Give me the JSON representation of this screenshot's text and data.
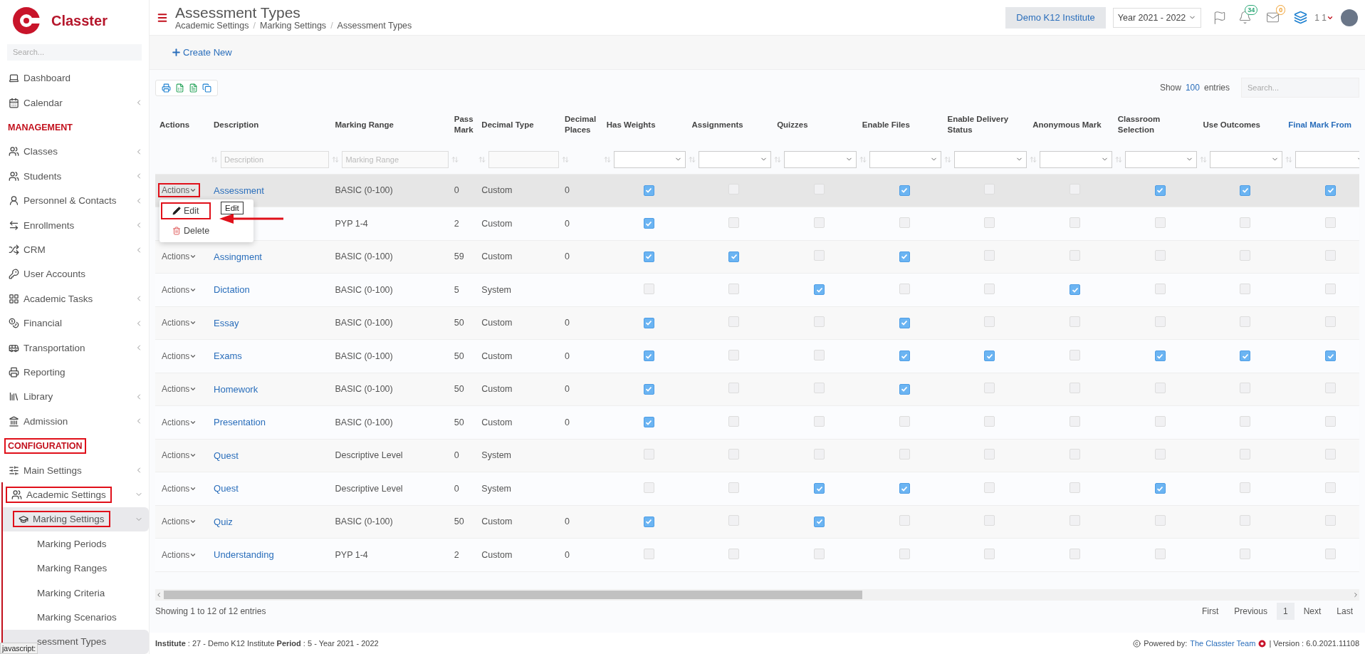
{
  "brand": {
    "name": "Classter"
  },
  "sidebar": {
    "search": {
      "placeholder": "Search..."
    },
    "items": [
      {
        "kind": "item",
        "label": "Dashboard"
      },
      {
        "kind": "item",
        "label": "Calendar",
        "expanded": false
      },
      {
        "kind": "section",
        "label": "MANAGEMENT",
        "annotated": false
      },
      {
        "kind": "item",
        "label": "Classes",
        "expanded": false
      },
      {
        "kind": "item",
        "label": "Students",
        "expanded": false
      },
      {
        "kind": "item",
        "label": "Personnel & Contacts",
        "expanded": false
      },
      {
        "kind": "item",
        "label": "Enrollments",
        "expanded": false
      },
      {
        "kind": "item",
        "label": "CRM",
        "expanded": false
      },
      {
        "kind": "item",
        "label": "User Accounts"
      },
      {
        "kind": "item",
        "label": "Academic Tasks",
        "expanded": false
      },
      {
        "kind": "item",
        "label": "Financial",
        "expanded": false
      },
      {
        "kind": "item",
        "label": "Transportation",
        "expanded": false
      },
      {
        "kind": "item",
        "label": "Reporting"
      },
      {
        "kind": "item",
        "label": "Library",
        "expanded": false
      },
      {
        "kind": "item",
        "label": "Admission",
        "expanded": false
      },
      {
        "kind": "section",
        "label": "CONFIGURATION",
        "annotated": true
      },
      {
        "kind": "item",
        "label": "Main Settings",
        "expanded": false
      },
      {
        "kind": "item",
        "label": "Academic Settings",
        "expanded": true,
        "annotated": true,
        "children": [
          {
            "label": "Marking Settings",
            "expanded": true,
            "annotated": true,
            "children": [
              {
                "label": "Marking Periods",
                "selected": false
              },
              {
                "label": "Marking Ranges",
                "selected": false
              },
              {
                "label": "Marking Criteria",
                "selected": false
              },
              {
                "label": "Marking Scenarios",
                "selected": false
              },
              {
                "label": "sessment Types",
                "selected": true
              }
            ]
          }
        ]
      }
    ],
    "status_tip": "javascript:"
  },
  "header": {
    "title": "Assessment Types",
    "breadcrumb": [
      "Academic Settings",
      "Marking Settings",
      "Assessment Types"
    ],
    "separator": "/",
    "institute": "Demo K12 Institute",
    "year": "Year 2021 - 2022",
    "notifications": "34",
    "messages": "0",
    "user": "1 1"
  },
  "toolbar": {
    "create": "Create New"
  },
  "table_tools": {
    "show": "Show",
    "page_size": "100",
    "entries": "entries",
    "search": {
      "placeholder": "Search..."
    }
  },
  "columns": [
    {
      "label": "Actions",
      "kind": "action",
      "sorted": false,
      "filter": {
        "kind": "none"
      }
    },
    {
      "label": "Description",
      "kind": "link",
      "sorted": false,
      "filter": {
        "kind": "text",
        "placeholder": "Description"
      }
    },
    {
      "label": "Marking Range",
      "kind": "text",
      "sorted": false,
      "filter": {
        "kind": "text",
        "placeholder": "Marking Range"
      }
    },
    {
      "label": "Pass Mark",
      "kind": "text",
      "sorted": false,
      "filter": {
        "kind": "none"
      }
    },
    {
      "label": "Decimal Type",
      "kind": "text",
      "sorted": false,
      "filter": {
        "kind": "input"
      }
    },
    {
      "label": "Decimal Places",
      "kind": "text",
      "sorted": false,
      "filter": {
        "kind": "none"
      }
    },
    {
      "label": "Has Weights",
      "kind": "check",
      "sorted": false,
      "filter": {
        "kind": "select"
      }
    },
    {
      "label": "Assignments",
      "kind": "check",
      "sorted": false,
      "filter": {
        "kind": "select"
      }
    },
    {
      "label": "Quizzes",
      "kind": "check",
      "sorted": false,
      "filter": {
        "kind": "select"
      }
    },
    {
      "label": "Enable Files",
      "kind": "check",
      "sorted": false,
      "filter": {
        "kind": "select"
      }
    },
    {
      "label": "Enable Delivery Status",
      "kind": "check",
      "sorted": false,
      "filter": {
        "kind": "select"
      }
    },
    {
      "label": "Anonymous Mark",
      "kind": "check",
      "sorted": false,
      "filter": {
        "kind": "select"
      }
    },
    {
      "label": "Classroom Selection",
      "kind": "check",
      "sorted": false,
      "filter": {
        "kind": "select"
      }
    },
    {
      "label": "Use Outcomes",
      "kind": "check",
      "sorted": false,
      "filter": {
        "kind": "select"
      }
    },
    {
      "label": "Final Mark From",
      "kind": "check",
      "sorted": true,
      "filter": {
        "kind": "select"
      }
    }
  ],
  "rows": [
    {
      "selected": true,
      "actions": {
        "label": "Actions",
        "annotated": true
      },
      "description": "Assessment",
      "range": "BASIC (0-100)",
      "pass": "0",
      "type": "Custom",
      "places": "0",
      "checks": [
        true,
        false,
        false,
        true,
        false,
        false,
        true,
        true,
        true
      ]
    },
    {
      "selected": false,
      "range": "PYP 1-4",
      "pass": "2",
      "type": "Custom",
      "places": "0",
      "checks": [
        true,
        false,
        false,
        false,
        false,
        false,
        false,
        false,
        false
      ]
    },
    {
      "selected": false,
      "actions": {
        "label": "Actions",
        "annotated": false
      },
      "description": "Assingment",
      "range": "BASIC (0-100)",
      "pass": "59",
      "type": "Custom",
      "places": "0",
      "checks": [
        true,
        true,
        false,
        true,
        false,
        false,
        false,
        false,
        false
      ]
    },
    {
      "selected": false,
      "actions": {
        "label": "Actions",
        "annotated": false
      },
      "description": "Dictation",
      "range": "BASIC (0-100)",
      "pass": "5",
      "type": "System",
      "checks": [
        false,
        false,
        true,
        false,
        false,
        true,
        false,
        false,
        false
      ]
    },
    {
      "selected": false,
      "actions": {
        "label": "Actions",
        "annotated": false
      },
      "description": "Essay",
      "range": "BASIC (0-100)",
      "pass": "50",
      "type": "Custom",
      "places": "0",
      "checks": [
        true,
        false,
        false,
        true,
        false,
        false,
        false,
        false,
        false
      ]
    },
    {
      "selected": false,
      "actions": {
        "label": "Actions",
        "annotated": false
      },
      "description": "Exams",
      "range": "BASIC (0-100)",
      "pass": "50",
      "type": "Custom",
      "places": "0",
      "checks": [
        true,
        false,
        false,
        true,
        true,
        false,
        true,
        true,
        true
      ]
    },
    {
      "selected": false,
      "actions": {
        "label": "Actions",
        "annotated": false
      },
      "description": "Homework",
      "range": "BASIC (0-100)",
      "pass": "50",
      "type": "Custom",
      "places": "0",
      "checks": [
        true,
        false,
        false,
        true,
        false,
        false,
        false,
        false,
        false
      ]
    },
    {
      "selected": false,
      "actions": {
        "label": "Actions",
        "annotated": false
      },
      "description": "Presentation",
      "range": "BASIC (0-100)",
      "pass": "50",
      "type": "Custom",
      "places": "0",
      "checks": [
        true,
        false,
        false,
        false,
        false,
        false,
        false,
        false,
        false
      ]
    },
    {
      "selected": false,
      "actions": {
        "label": "Actions",
        "annotated": false
      },
      "description": "Quest",
      "range": "Descriptive Level",
      "pass": "0",
      "type": "System",
      "checks": [
        false,
        false,
        false,
        false,
        false,
        false,
        false,
        false,
        false
      ]
    },
    {
      "selected": false,
      "actions": {
        "label": "Actions",
        "annotated": false
      },
      "description": "Quest",
      "range": "Descriptive Level",
      "pass": "0",
      "type": "System",
      "checks": [
        false,
        false,
        true,
        true,
        false,
        false,
        true,
        false,
        false
      ]
    },
    {
      "selected": false,
      "actions": {
        "label": "Actions",
        "annotated": false
      },
      "description": "Quiz",
      "range": "BASIC (0-100)",
      "pass": "50",
      "type": "Custom",
      "places": "0",
      "checks": [
        true,
        false,
        true,
        false,
        false,
        false,
        false,
        false,
        false
      ]
    },
    {
      "selected": false,
      "actions": {
        "label": "Actions",
        "annotated": false
      },
      "description": "Understanding",
      "range": "PYP 1-4",
      "pass": "2",
      "type": "Custom",
      "places": "0",
      "checks": [
        false,
        false,
        false,
        false,
        false,
        false,
        false,
        false,
        false
      ]
    }
  ],
  "action_menu": {
    "items": [
      {
        "kind": "edit",
        "label": "Edit",
        "annotated": true
      },
      {
        "kind": "delete",
        "label": "Delete",
        "annotated": false
      }
    ],
    "tooltip": "Edit"
  },
  "summary": "Showing 1 to 12 of 12 entries",
  "pagination": [
    {
      "label": "First",
      "selected": false
    },
    {
      "label": "Previous",
      "selected": false
    },
    {
      "label": "1",
      "selected": true
    },
    {
      "label": "Next",
      "selected": false
    },
    {
      "label": "Last",
      "selected": false
    }
  ],
  "footer": {
    "info": "**Institute** : 27 - Demo K12 Institute **Period** : 5 - Year 2021 - 2022",
    "powered": "Powered by:",
    "team": "The Classter Team",
    "version": "| Version : 6.0.2021.11108"
  }
}
